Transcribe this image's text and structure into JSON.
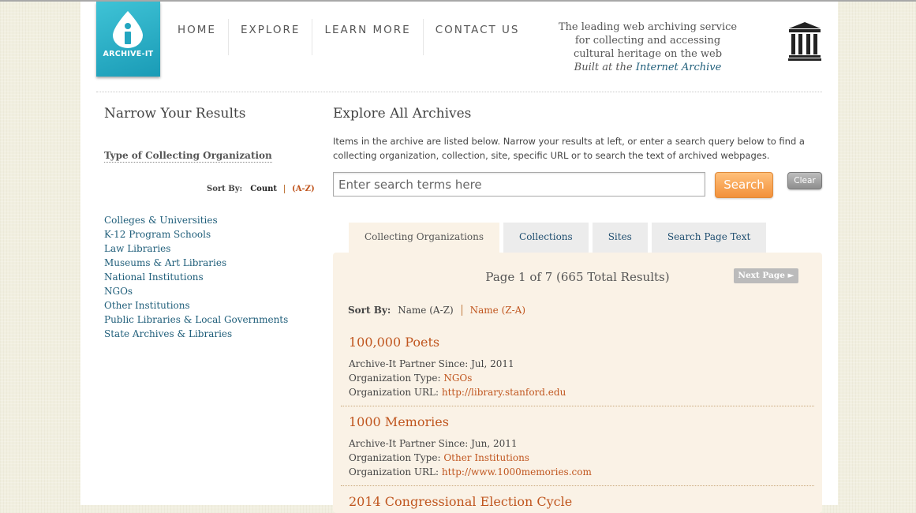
{
  "brand": {
    "logo_text": "ARCHIVE-IT"
  },
  "nav": {
    "items": [
      "HOME",
      "EXPLORE",
      "LEARN MORE",
      "CONTACT US"
    ]
  },
  "tagline": {
    "line1": "The leading web archiving service",
    "line2": "for collecting and accessing",
    "line3": "cultural heritage on the web",
    "built_prefix": "Built at the ",
    "built_link": "Internet Archive"
  },
  "sidebar": {
    "title": "Narrow Your Results",
    "subtitle": "Type of Collecting Organization",
    "sort_label": "Sort By:",
    "sort_count": "Count",
    "sort_az": "(A-Z)",
    "items": [
      "Colleges & Universities",
      "K-12 Program Schools",
      "Law Libraries",
      "Museums & Art Libraries",
      "National Institutions",
      "NGOs",
      "Other Institutions",
      "Public Libraries & Local Governments",
      "State Archives & Libraries"
    ]
  },
  "main": {
    "title": "Explore All Archives",
    "description": "Items in the archive are listed below. Narrow your results at left, or enter a search query below to find a collecting organization, collection, site, specific URL or to search the text of archived webpages.",
    "search_placeholder": "Enter search terms here",
    "search_button": "Search",
    "clear_button": "Clear",
    "tabs": [
      "Collecting Organizations",
      "Collections",
      "Sites",
      "Search Page Text"
    ],
    "active_tab": 0
  },
  "results": {
    "pager": "Page 1 of 7 (665 Total Results)",
    "next_button": "Next Page ►",
    "sort_label": "Sort By:",
    "sort_name_az": "Name (A-Z)",
    "sort_name_za": "Name (Z-A)",
    "entries": [
      {
        "name": "100,000 Poets",
        "partner_label": "Archive-It Partner Since: ",
        "partner_since": "Jul, 2011",
        "type_label": "Organization Type: ",
        "type": "NGOs",
        "url_label": "Organization URL: ",
        "url": "http://library.stanford.edu"
      },
      {
        "name": "1000 Memories",
        "partner_label": "Archive-It Partner Since: ",
        "partner_since": "Jun, 2011",
        "type_label": "Organization Type: ",
        "type": "Other Institutions",
        "url_label": "Organization URL: ",
        "url": "http://www.1000memories.com"
      },
      {
        "name": "2014 Congressional Election Cycle"
      }
    ]
  },
  "colors": {
    "accent": "#c0561f",
    "link": "#1f5e7a",
    "logo": "#1a9bb6",
    "search": "#f2913b"
  }
}
